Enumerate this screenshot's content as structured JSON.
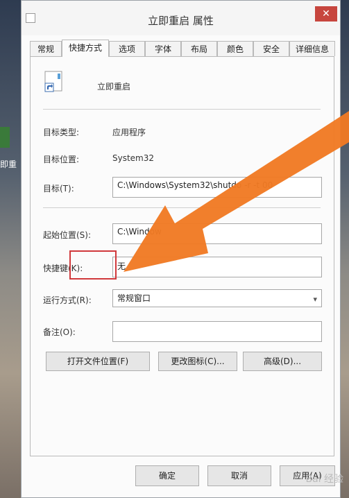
{
  "desktop": {
    "icon_caption": "即重"
  },
  "window": {
    "title": "立即重启 属性",
    "close_glyph": "✕"
  },
  "tabs": [
    {
      "label": "常规"
    },
    {
      "label": "快捷方式"
    },
    {
      "label": "选项"
    },
    {
      "label": "字体"
    },
    {
      "label": "布局"
    },
    {
      "label": "颜色"
    },
    {
      "label": "安全"
    },
    {
      "label": "详细信息"
    }
  ],
  "shortcut": {
    "name": "立即重启",
    "target_type_label": "目标类型:",
    "target_type_value": "应用程序",
    "target_location_label": "目标位置:",
    "target_location_value": "System32",
    "target_label": "目标(T):",
    "target_value": "C:\\Windows\\System32\\shutdo          -r -t 00",
    "start_in_label": "起始位置(S):",
    "start_in_value": "C:\\Window",
    "hotkey_label": "快捷键(K):",
    "hotkey_value": "无",
    "run_label": "运行方式(R):",
    "run_value": "常规窗口",
    "comment_label": "备注(O):",
    "comment_value": ""
  },
  "buttons": {
    "open_location": "打开文件位置(F)",
    "change_icon": "更改图标(C)...",
    "advanced": "高级(D)...",
    "ok": "确定",
    "cancel": "取消",
    "apply": "应用(A)"
  },
  "watermark": "Bai 经验",
  "colors": {
    "highlight": "#d0383b",
    "arrow": "#f07a23"
  }
}
